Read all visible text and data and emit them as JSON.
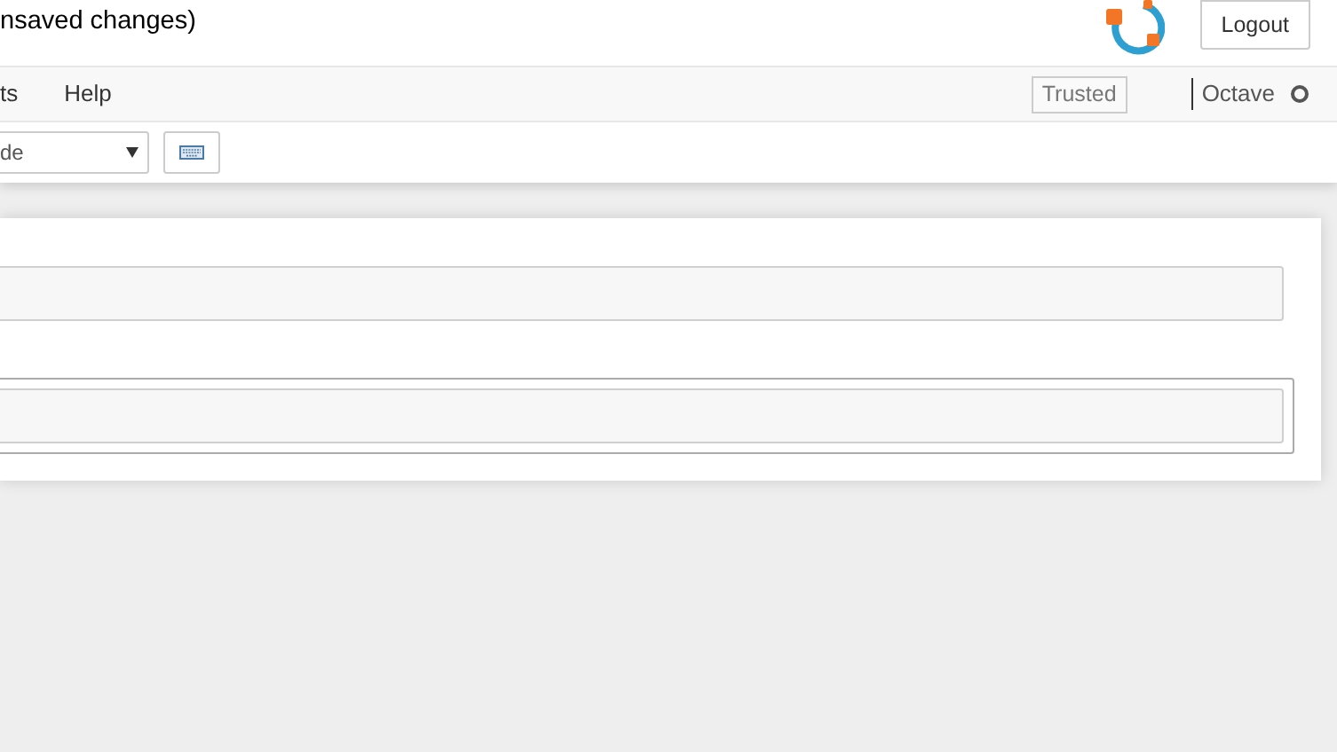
{
  "header": {
    "title": "nsaved changes)",
    "logout": "Logout"
  },
  "menubar": {
    "items": [
      "ts",
      "Help"
    ],
    "trusted": "Trusted",
    "kernel": "Octave",
    "kernel_busy": false
  },
  "toolbar": {
    "cell_type": "de"
  },
  "cells": [
    {
      "selected": false
    },
    {
      "selected": true
    }
  ]
}
